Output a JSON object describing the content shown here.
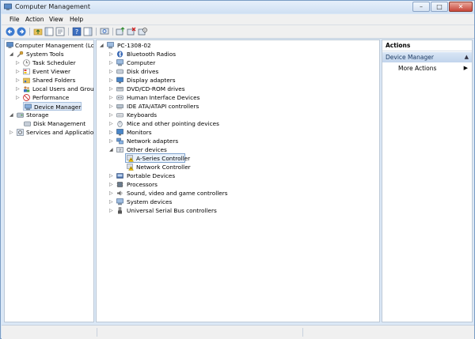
{
  "window": {
    "title": "Computer Management"
  },
  "caption_buttons": {
    "minimize": "–",
    "maximize": "□",
    "close": "✕"
  },
  "menu": [
    {
      "label": "File",
      "u": "F"
    },
    {
      "label": "Action",
      "u": "A"
    },
    {
      "label": "View",
      "u": "V"
    },
    {
      "label": "Help",
      "u": "H"
    }
  ],
  "left_tree": [
    {
      "label": "Computer Management (Local",
      "icon": "computer-management-icon",
      "expander": ""
    },
    {
      "label": "System Tools",
      "icon": "tools-icon",
      "expander": "◢"
    },
    {
      "label": "Task Scheduler",
      "icon": "clock-icon",
      "expander": "▷"
    },
    {
      "label": "Event Viewer",
      "icon": "event-viewer-icon",
      "expander": "▷"
    },
    {
      "label": "Shared Folders",
      "icon": "shared-folder-icon",
      "expander": "▷"
    },
    {
      "label": "Local Users and Groups",
      "icon": "users-icon",
      "expander": "▷"
    },
    {
      "label": "Performance",
      "icon": "performance-icon",
      "expander": "▷"
    },
    {
      "label": "Device Manager",
      "icon": "device-manager-icon",
      "expander": ""
    },
    {
      "label": "Storage",
      "icon": "storage-icon",
      "expander": "◢"
    },
    {
      "label": "Disk Management",
      "icon": "disk-icon",
      "expander": ""
    },
    {
      "label": "Services and Applications",
      "icon": "services-icon",
      "expander": "▷"
    }
  ],
  "device_tree": [
    {
      "label": "PC-1308-02",
      "icon": "computer-icon",
      "expander": "◢"
    },
    {
      "label": "Bluetooth Radios",
      "icon": "bluetooth-icon",
      "expander": "▷"
    },
    {
      "label": "Computer",
      "icon": "computer-icon",
      "expander": "▷"
    },
    {
      "label": "Disk drives",
      "icon": "disk-drive-icon",
      "expander": "▷"
    },
    {
      "label": "Display adapters",
      "icon": "display-icon",
      "expander": "▷"
    },
    {
      "label": "DVD/CD-ROM drives",
      "icon": "dvd-icon",
      "expander": "▷"
    },
    {
      "label": "Human Interface Devices",
      "icon": "hid-icon",
      "expander": "▷"
    },
    {
      "label": "IDE ATA/ATAPI controllers",
      "icon": "ide-icon",
      "expander": "▷"
    },
    {
      "label": "Keyboards",
      "icon": "keyboard-icon",
      "expander": "▷"
    },
    {
      "label": "Mice and other pointing devices",
      "icon": "mouse-icon",
      "expander": "▷"
    },
    {
      "label": "Monitors",
      "icon": "monitor-icon",
      "expander": "▷"
    },
    {
      "label": "Network adapters",
      "icon": "network-icon",
      "expander": "▷"
    },
    {
      "label": "Other devices",
      "icon": "other-devices-icon",
      "expander": "◢"
    },
    {
      "label": "A-Series Controller",
      "icon": "warning-device-icon",
      "expander": ""
    },
    {
      "label": "Network Controller",
      "icon": "warning-device-icon",
      "expander": ""
    },
    {
      "label": "Portable Devices",
      "icon": "portable-icon",
      "expander": "▷"
    },
    {
      "label": "Processors",
      "icon": "processor-icon",
      "expander": "▷"
    },
    {
      "label": "Sound, video and game controllers",
      "icon": "sound-icon",
      "expander": "▷"
    },
    {
      "label": "System devices",
      "icon": "system-icon",
      "expander": "▷"
    },
    {
      "label": "Universal Serial Bus controllers",
      "icon": "usb-icon",
      "expander": "▷"
    }
  ],
  "actions": {
    "header": "Actions",
    "section": "Device Manager",
    "section_arrow": "▲",
    "item": "More Actions",
    "item_arrow": "▶"
  },
  "colors": {
    "accent": "#3a6ea5",
    "warning": "#f2c200",
    "selection": "#dfe9f6"
  }
}
